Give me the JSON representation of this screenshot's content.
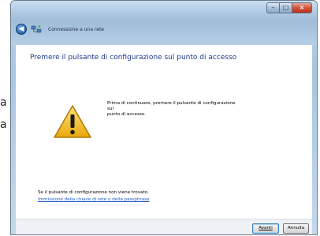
{
  "background": {
    "fragment_1": "a",
    "fragment_2": "a"
  },
  "window": {
    "title": "Connessione a una rete",
    "caption_buttons": {
      "minimize_icon": "minimize-icon",
      "maximize_icon": "maximize-icon",
      "close_icon": "close-icon"
    }
  },
  "main": {
    "heading": "Premere il pulsante di configurazione sul punto di accesso",
    "instruction_lines": [
      "Prima di continuare, premere il pulsante di configurazione",
      "sul",
      "punto di accesso."
    ],
    "not_found_text": "Se il pulsante di configurazione non viene trovato.",
    "key_link": "Immissione della chiave di rete o della passphrase"
  },
  "footer": {
    "next_label": "Avanti",
    "cancel_label": "Annulla"
  },
  "colors": {
    "heading": "#1e3a8c",
    "link": "#1a56c8",
    "warning_fill": "#f4c01c"
  }
}
